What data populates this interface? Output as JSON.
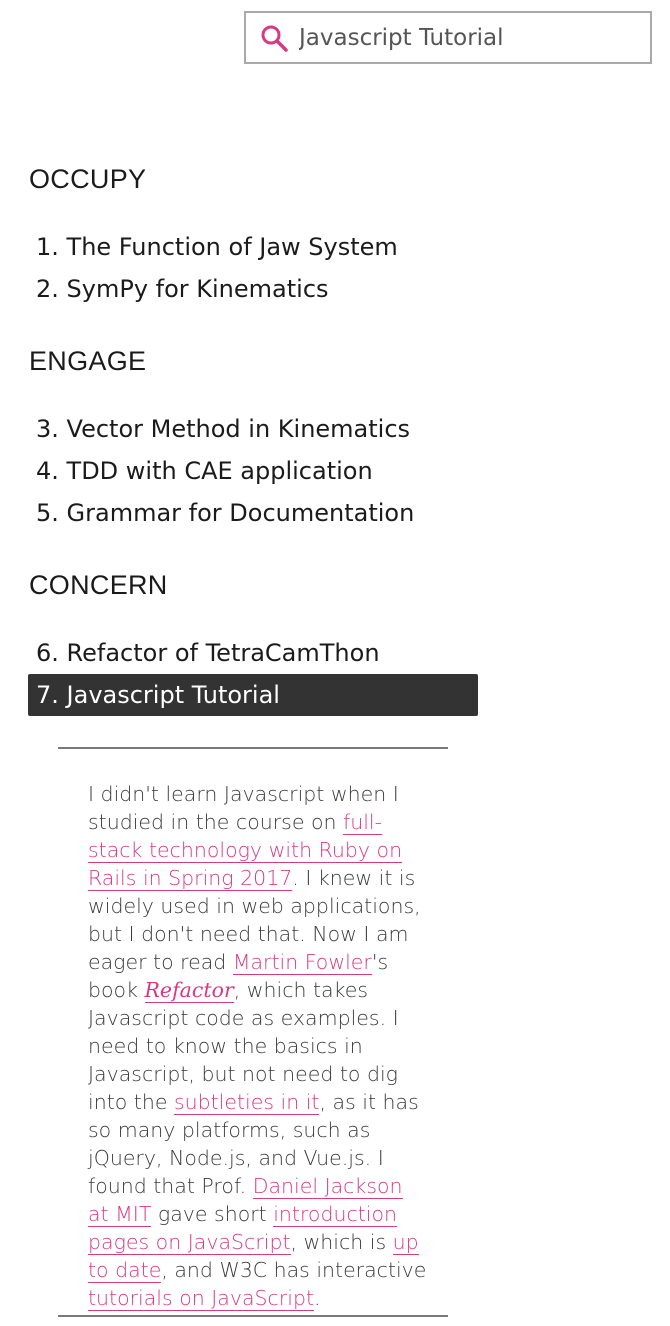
{
  "search": {
    "value": "Javascript Tutorial",
    "icon": "search-icon",
    "icon_color": "#d63a82"
  },
  "sections": [
    {
      "heading": "OCCUPY",
      "items": [
        "1. The Function of Jaw System",
        "2. SymPy for Kinematics"
      ]
    },
    {
      "heading": "ENGAGE",
      "items": [
        "3. Vector Method in Kinematics",
        "4. TDD with CAE application",
        "5. Grammar for Documentation"
      ]
    },
    {
      "heading": "CONCERN",
      "items": [
        "6. Refactor of TetraCamThon",
        "7. Javascript Tutorial"
      ]
    }
  ],
  "selected_item": "7. Javascript Tutorial",
  "colors": {
    "accent": "#d63a82",
    "selected_bg": "#333333",
    "text": "#1b1b1b"
  },
  "description": {
    "t1": "I didn't learn Javascript when I studied in the course on ",
    "l1": "full-stack technology with Ruby on Rails in Spring 2017",
    "t2": ". I knew it is widely used in web applications, but I don't need that. Now I am eager to read ",
    "l2": "Martin Fowler",
    "t3": "'s book ",
    "l3": "Refactor",
    "t4": ", which takes Javascript code as examples. I need to know the basics in Javascript, but not need to dig into the ",
    "l4": "subtleties in it",
    "t5": ", as it has so many platforms, such as jQuery, Node.js, and Vue.js. I found that Prof. ",
    "l5": "Daniel Jackson at MIT",
    "t6": " gave short ",
    "l6": "introduction pages on JavaScript",
    "t7": ", which is ",
    "l7": "up to date",
    "t8": ", and W3C has interactive ",
    "l8": "tutorials on JavaScript",
    "t9": "."
  }
}
